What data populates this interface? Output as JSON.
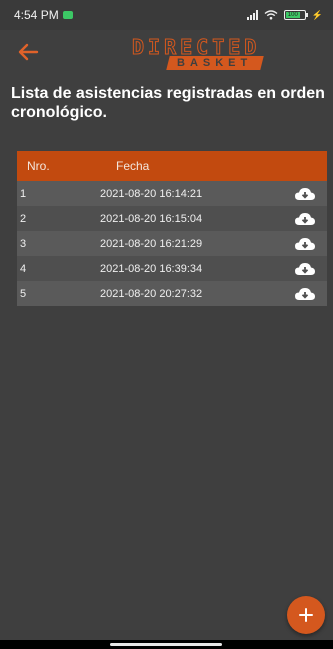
{
  "status_bar": {
    "time": "4:54 PM",
    "battery": "100"
  },
  "header": {
    "logo_top": "DIRECTED",
    "logo_bottom": "BASKET",
    "back_icon": "arrow-left-icon"
  },
  "page": {
    "title": "Lista de asistencias registradas en orden cronológico."
  },
  "table": {
    "columns": [
      "Nro.",
      "Fecha"
    ],
    "rows": [
      {
        "nro": "1",
        "fecha": "2021-08-20 16:14:21"
      },
      {
        "nro": "2",
        "fecha": "2021-08-20 16:15:04"
      },
      {
        "nro": "3",
        "fecha": "2021-08-20 16:21:29"
      },
      {
        "nro": "4",
        "fecha": "2021-08-20 16:39:34"
      },
      {
        "nro": "5",
        "fecha": "2021-08-20 20:27:32"
      }
    ],
    "row_icon": "cloud-download-icon"
  },
  "fab": {
    "icon": "plus-icon"
  },
  "colors": {
    "background": "#3f3f3f",
    "accent": "#d4581e",
    "header_row": "#c24a0f"
  }
}
